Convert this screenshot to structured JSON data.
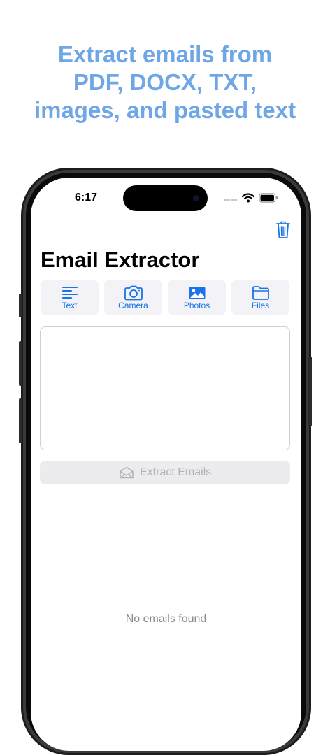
{
  "headline": {
    "line1": "Extract emails from",
    "line2": "PDF, DOCX, TXT,",
    "line3": "images, and pasted text"
  },
  "status_bar": {
    "time": "6:17"
  },
  "app": {
    "title": "Email Extractor",
    "source_buttons": [
      {
        "label": "Text",
        "icon": "text-align-left-icon"
      },
      {
        "label": "Camera",
        "icon": "camera-icon"
      },
      {
        "label": "Photos",
        "icon": "photo-icon"
      },
      {
        "label": "Files",
        "icon": "folder-icon"
      }
    ],
    "text_input_value": "",
    "extract_button_label": "Extract Emails",
    "empty_state": "No emails found"
  },
  "colors": {
    "headline": "#6fa6e6",
    "accent": "#1a73e8",
    "disabled_text": "#b1b1b6"
  }
}
